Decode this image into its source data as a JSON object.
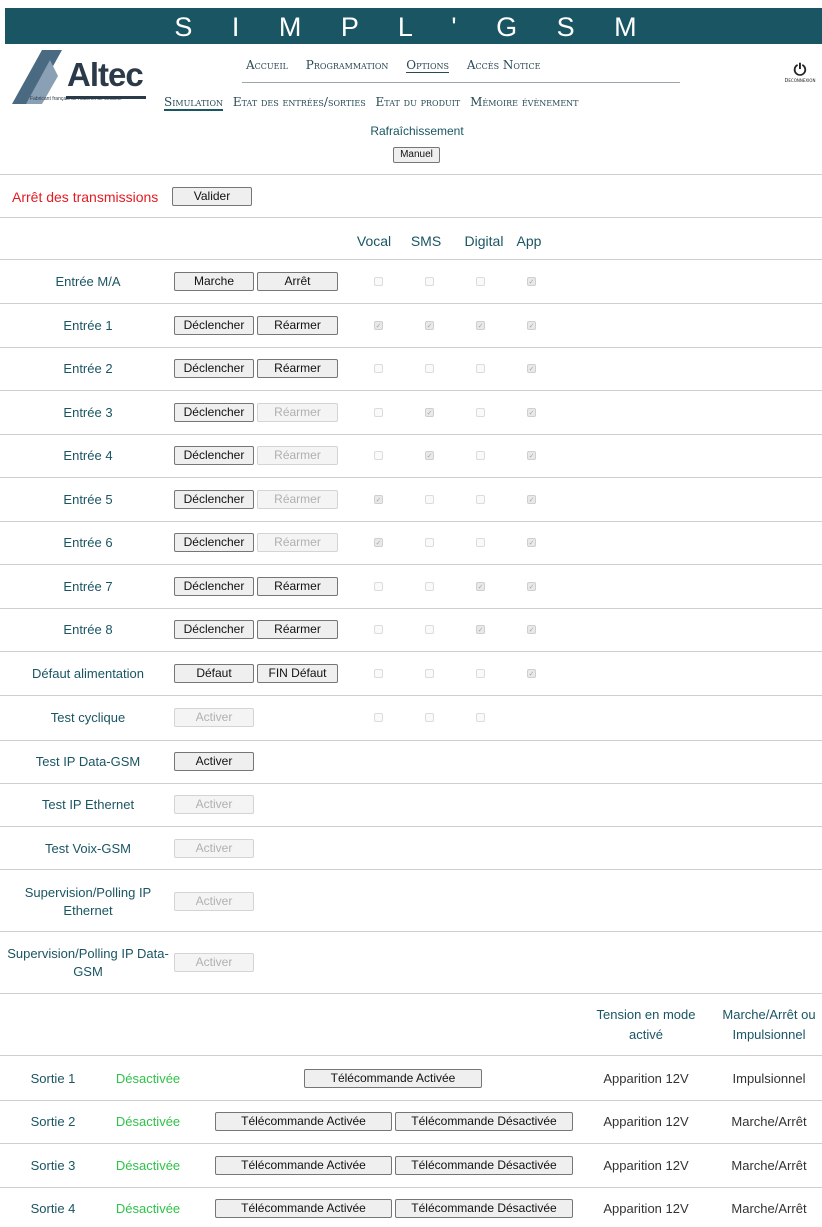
{
  "app_title": "S I M P L ' G S M",
  "logo": {
    "brand": "Altec",
    "tagline": "Fabricant français de matériel de sécurité"
  },
  "nav": {
    "top": [
      "Accueil",
      "Programmation",
      "Options",
      "Accès Notice"
    ],
    "top_active": "Options",
    "sub": [
      "Simulation",
      "Etat des entrées/sorties",
      "Etat du produit",
      "Mémoire évènement"
    ],
    "sub_active": "Simulation"
  },
  "logout_label": "Deconnexion",
  "refresh": {
    "label": "Rafraîchissement",
    "button": "Manuel"
  },
  "stop_transmissions": {
    "label": "Arrêt des transmissions",
    "button": "Valider"
  },
  "columns": [
    "Vocal",
    "SMS",
    "Digital",
    "App"
  ],
  "inputs": [
    {
      "label": "Entrée M/A",
      "btn1": "Marche",
      "btn2": "Arrêt",
      "btn2_disabled": false,
      "checks": [
        false,
        false,
        false,
        true
      ]
    },
    {
      "label": "Entrée 1",
      "btn1": "Déclencher",
      "btn2": "Réarmer",
      "btn2_disabled": false,
      "checks": [
        true,
        true,
        true,
        true
      ]
    },
    {
      "label": "Entrée 2",
      "btn1": "Déclencher",
      "btn2": "Réarmer",
      "btn2_disabled": false,
      "checks": [
        false,
        false,
        false,
        true
      ]
    },
    {
      "label": "Entrée 3",
      "btn1": "Déclencher",
      "btn2": "Réarmer",
      "btn2_disabled": true,
      "checks": [
        false,
        true,
        false,
        true
      ]
    },
    {
      "label": "Entrée 4",
      "btn1": "Déclencher",
      "btn2": "Réarmer",
      "btn2_disabled": true,
      "checks": [
        false,
        true,
        false,
        true
      ]
    },
    {
      "label": "Entrée 5",
      "btn1": "Déclencher",
      "btn2": "Réarmer",
      "btn2_disabled": true,
      "checks": [
        true,
        false,
        false,
        true
      ]
    },
    {
      "label": "Entrée 6",
      "btn1": "Déclencher",
      "btn2": "Réarmer",
      "btn2_disabled": true,
      "checks": [
        true,
        false,
        false,
        true
      ]
    },
    {
      "label": "Entrée 7",
      "btn1": "Déclencher",
      "btn2": "Réarmer",
      "btn2_disabled": false,
      "checks": [
        false,
        false,
        true,
        true
      ]
    },
    {
      "label": "Entrée 8",
      "btn1": "Déclencher",
      "btn2": "Réarmer",
      "btn2_disabled": false,
      "checks": [
        false,
        false,
        true,
        true
      ]
    },
    {
      "label": "Défaut alimentation",
      "btn1": "Défaut",
      "btn2": "FIN Défaut",
      "btn2_disabled": false,
      "checks": [
        false,
        false,
        false,
        true
      ]
    }
  ],
  "tests": [
    {
      "label": "Test cyclique",
      "button": "Activer",
      "disabled": true,
      "checks": [
        false,
        false,
        false
      ]
    },
    {
      "label": "Test IP Data-GSM",
      "button": "Activer",
      "disabled": false
    },
    {
      "label": "Test IP Ethernet",
      "button": "Activer",
      "disabled": true
    },
    {
      "label": "Test Voix-GSM",
      "button": "Activer",
      "disabled": true
    },
    {
      "label": "Supervision/Polling IP Ethernet",
      "button": "Activer",
      "disabled": true
    },
    {
      "label": "Supervision/Polling IP Data-GSM",
      "button": "Activer",
      "disabled": true
    }
  ],
  "outputs_header": {
    "tension": "Tension en mode activé",
    "mode": "Marche/Arrêt ou Impulsionnel"
  },
  "outputs": [
    {
      "label": "Sortie 1",
      "state": "Désactivée",
      "on_button": "Télécommande Activée",
      "off_button": "",
      "tension": "Apparition 12V",
      "mode": "Impulsionnel"
    },
    {
      "label": "Sortie 2",
      "state": "Désactivée",
      "on_button": "Télécommande Activée",
      "off_button": "Télécommande Désactivée",
      "tension": "Apparition 12V",
      "mode": "Marche/Arrêt"
    },
    {
      "label": "Sortie 3",
      "state": "Désactivée",
      "on_button": "Télécommande Activée",
      "off_button": "Télécommande Désactivée",
      "tension": "Apparition 12V",
      "mode": "Marche/Arrêt"
    },
    {
      "label": "Sortie 4",
      "state": "Désactivée",
      "on_button": "Télécommande Activée",
      "off_button": "Télécommande Désactivée",
      "tension": "Apparition 12V",
      "mode": "Marche/Arrêt"
    }
  ],
  "colors": {
    "header": "#1a5563",
    "label": "#1a5563",
    "alert": "#e31b23",
    "state_off": "#2fc24a"
  }
}
